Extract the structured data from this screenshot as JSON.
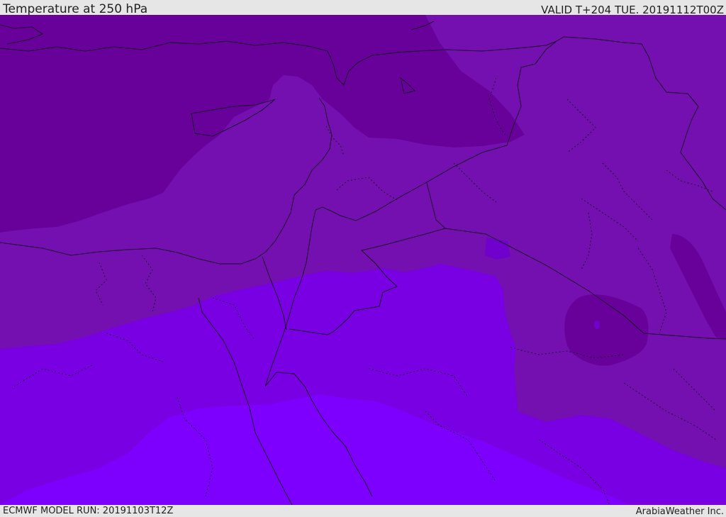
{
  "header": {
    "title": "Temperature at 250 hPa",
    "valid": "VALID T+204 TUE. 20191112T00Z"
  },
  "footer": {
    "model_run": "ECMWF MODEL RUN: 20191103T12Z",
    "credit": "ArabiaWeather Inc."
  },
  "map": {
    "parameter": "temperature",
    "pressure_level_hpa": 250,
    "colors": {
      "coldest": "#68009a",
      "cold": "#7510b0",
      "mid": "#7000cc",
      "warm": "#7800e2",
      "warmest": "#7d00ff",
      "border": "#1a0a2a"
    }
  }
}
